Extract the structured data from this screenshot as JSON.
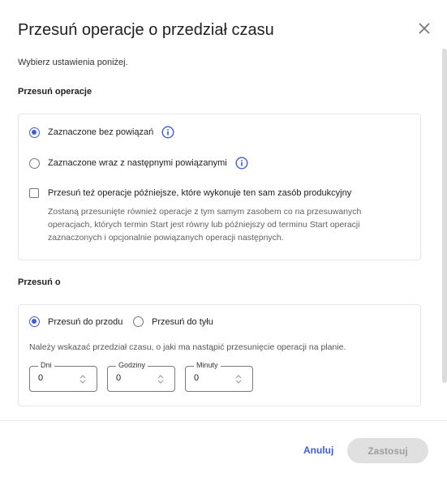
{
  "dialog": {
    "title": "Przesuń operacje o przedział czasu",
    "subtitle": "Wybierz ustawienia poniżej."
  },
  "shift_operations": {
    "label": "Przesuń operacje",
    "options": [
      {
        "label": "Zaznaczone bez powiązań",
        "checked": true,
        "icon": "info-icon"
      },
      {
        "label": "Zaznaczone wraz z następnymi powiązanymi",
        "checked": false,
        "icon": "info-icon"
      }
    ],
    "checkbox": {
      "label": "Przesuń też operacje późniejsze, które wykonuje ten sam zasób produkcyjny",
      "checked": false,
      "description": "Zostaną przesunięte również operacje z tym samym zasobem co na przesuwanych operacjach, których termin Start jest równy lub późniejszy od terminu Start operacji zaznaczonych i opcjonalnie powiązanych operacji następnych."
    }
  },
  "shift_by": {
    "label": "Przesuń o",
    "direction": [
      {
        "label": "Przesuń do przodu",
        "checked": true
      },
      {
        "label": "Przesuń do tyłu",
        "checked": false
      }
    ],
    "hint": "Należy wskazać przedział czasu, o jaki ma nastąpić przesunięcie operacji na planie.",
    "fields": [
      {
        "label": "Dni",
        "value": "0"
      },
      {
        "label": "Godziny",
        "value": "0"
      },
      {
        "label": "Minuty",
        "value": "0"
      }
    ]
  },
  "footer": {
    "cancel_label": "Anuluj",
    "apply_label": "Zastosuj"
  },
  "colors": {
    "accent": "#3f5bd6",
    "disabled_bg": "#e0e0e0",
    "disabled_text": "#9e9e9e"
  }
}
